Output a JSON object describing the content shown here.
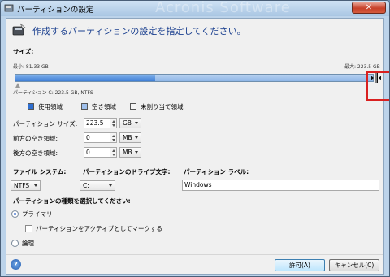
{
  "window": {
    "title": "パーティションの設定",
    "watermark": "Acronis Software"
  },
  "header": {
    "text": "作成するパーティションの設定を指定してください。"
  },
  "size": {
    "section_label": "サイズ:",
    "min_label": "最小: 81.33 GB",
    "max_label": "最大: 223.5 GB",
    "partition_info": "パーティション C:   223.5 GB,  NTFS",
    "bar_used_fraction": 0.39,
    "bar_free_fraction": 0.61
  },
  "legend": {
    "used": "使用領域",
    "free": "空き領域",
    "unallocated": "未割り当て領域"
  },
  "fields": {
    "partition_size_label": "パーティション サイズ:",
    "partition_size_value": "223.5",
    "partition_size_unit": "GB",
    "free_before_label": "前方の空き領域:",
    "free_before_value": "0",
    "free_before_unit": "MB",
    "free_after_label": "後方の空き領域:",
    "free_after_value": "0",
    "free_after_unit": "MB"
  },
  "filesystem": {
    "label": "ファイル システム:",
    "value": "NTFS"
  },
  "drive_letter": {
    "label": "パーティションのドライブ文字:",
    "value": "C:"
  },
  "partition_label": {
    "label": "パーティション ラベル:",
    "value": "Windows"
  },
  "partition_type": {
    "label": "パーティションの種類を選択してください:",
    "primary": "プライマリ",
    "mark_active": "パーティションをアクティブとしてマークする",
    "logical": "論理"
  },
  "buttons": {
    "ok": "許可(A)",
    "cancel": "キャンセル(C)"
  },
  "colors": {
    "accent": "#1a3f8f",
    "bar": "#3f7fd6",
    "highlight": "#d92020"
  }
}
